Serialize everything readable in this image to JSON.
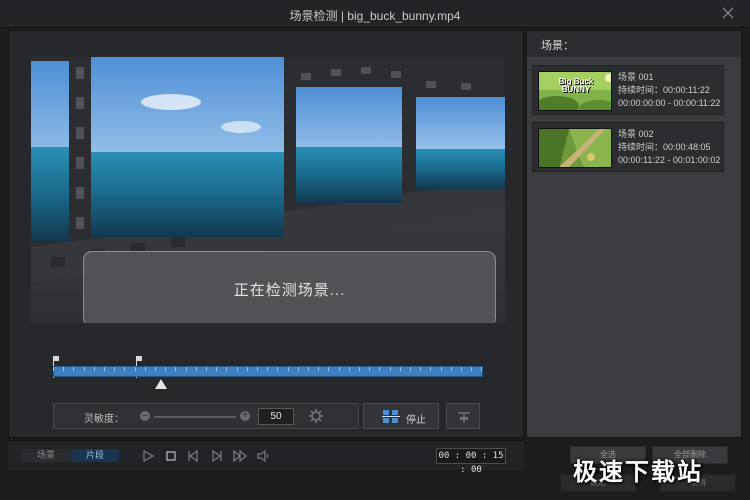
{
  "window": {
    "title": "场景检测 | big_buck_bunny.mp4"
  },
  "preview": {
    "status_text": "正在检测场景..."
  },
  "timeline": {
    "progress": 0.25
  },
  "sensitivity": {
    "label": "灵敏度：",
    "value": "50"
  },
  "stop_button": {
    "label": "停止"
  },
  "bottom": {
    "tab_scenes": "场景",
    "tab_clips": "片段",
    "timecode": "00 : 00 : 15 : 00"
  },
  "scenes_panel": {
    "header": "场景：",
    "items": [
      {
        "name": "场景 001",
        "duration": "持续时间：00:00:11:22",
        "range": "00:00:00:00 - 00:00:11:22",
        "thumb_text": "Big Buck BUNNY"
      },
      {
        "name": "场景 002",
        "duration": "持续时间：00:00:48:05",
        "range": "00:00:11:22 - 00:01:00:02"
      }
    ]
  },
  "footer": {
    "btn1": "全选",
    "btn2": "全部删除",
    "btn3": "确定",
    "btn4": "取消"
  },
  "watermark": "极速下载站",
  "icons": [
    "close-icon",
    "gear-icon",
    "stop-icon",
    "split-icon",
    "play-icon",
    "stop-square-icon",
    "prev-frame-icon",
    "next-frame-icon",
    "fast-forward-icon",
    "volume-icon"
  ]
}
